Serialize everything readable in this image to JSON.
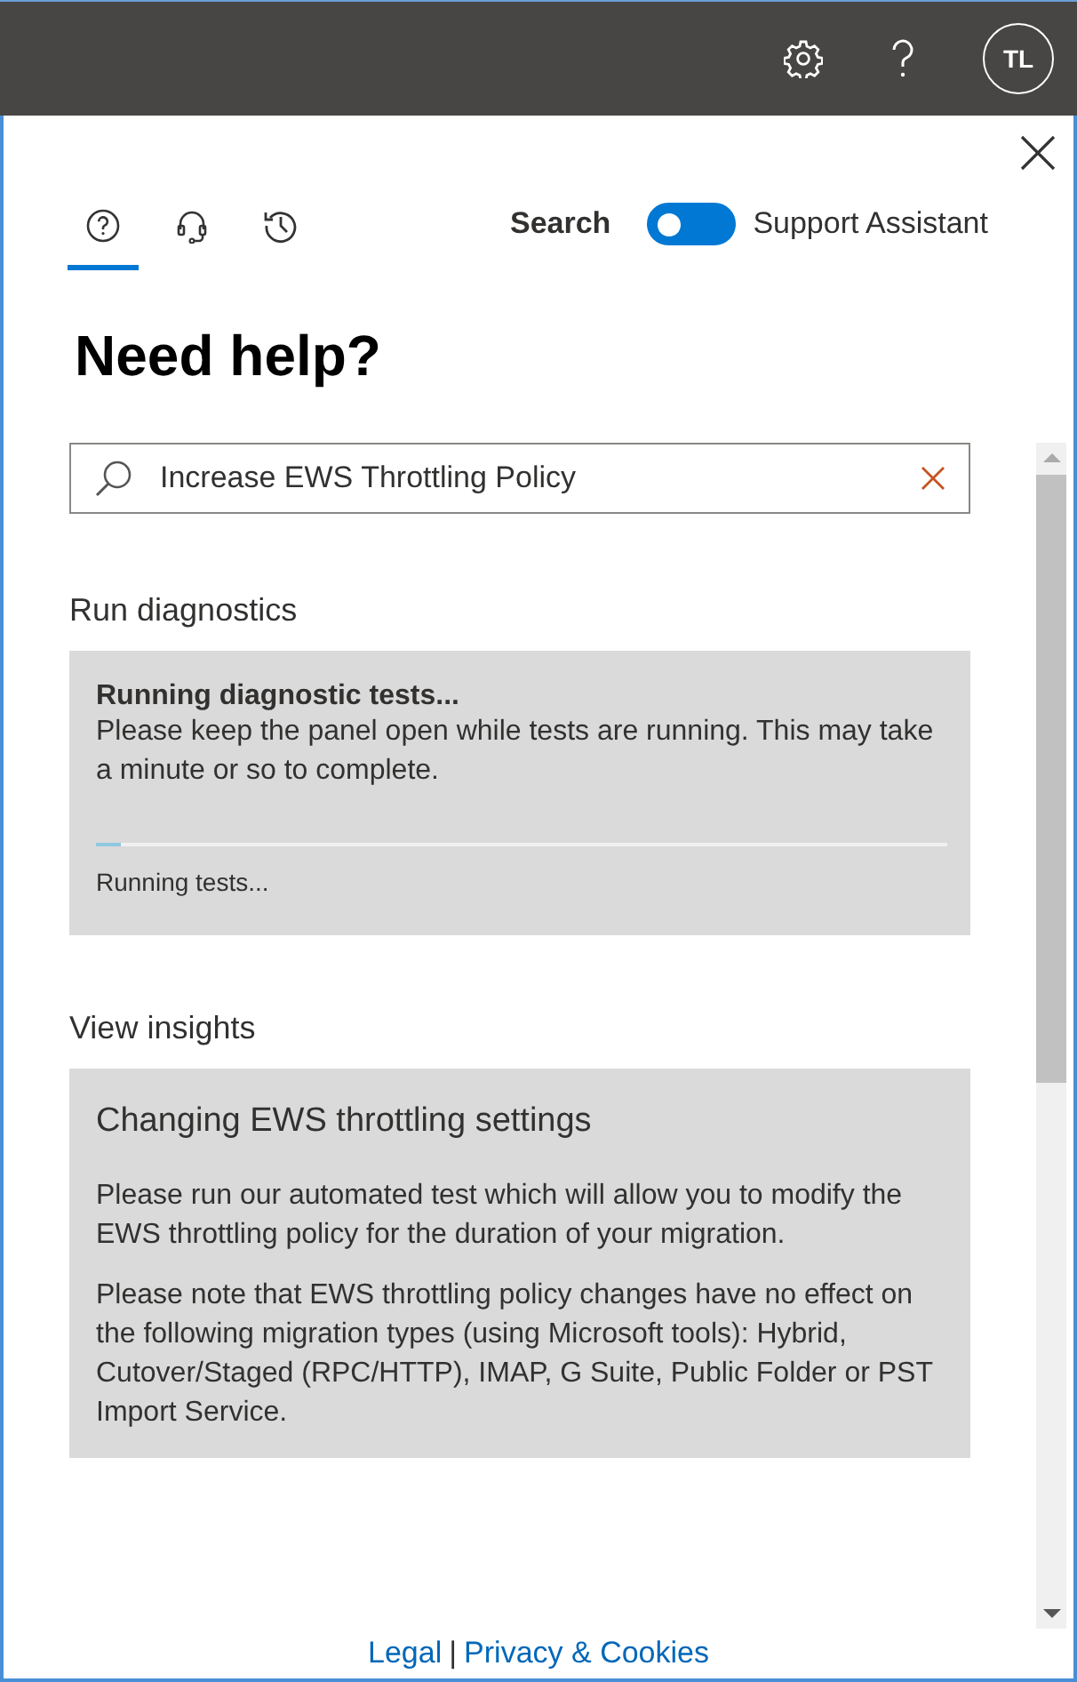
{
  "top_bar": {
    "avatar_initials": "TL"
  },
  "tabs": [
    {
      "kind": "help",
      "selected": true
    },
    {
      "kind": "headset",
      "selected": false
    },
    {
      "kind": "history",
      "selected": false
    }
  ],
  "mode_toggle": {
    "left_label": "Search",
    "right_label": "Support Assistant",
    "on": false
  },
  "heading": "Need help?",
  "search": {
    "value": "Increase EWS Throttling Policy"
  },
  "diagnostics": {
    "title": "Run diagnostics",
    "card_title": "Running diagnostic tests...",
    "card_text": "Please keep the panel open while tests are running. This may take a minute or so to complete.",
    "level": 0.03,
    "status": "Running tests..."
  },
  "insights": {
    "title": "View insights",
    "card_title": "Changing EWS throttling settings",
    "paragraphs": [
      "Please run our automated test which will allow you to modify the EWS throttling policy for the duration of your migration.",
      "Please note that EWS throttling policy changes have no effect on the following migration types (using Microsoft tools): Hybrid, Cutover/Staged (RPC/HTTP), IMAP, G Suite, Public Folder or PST Import Service."
    ]
  },
  "footer": {
    "links": [
      "Legal",
      "Privacy & Cookies"
    ],
    "separator": "|"
  }
}
